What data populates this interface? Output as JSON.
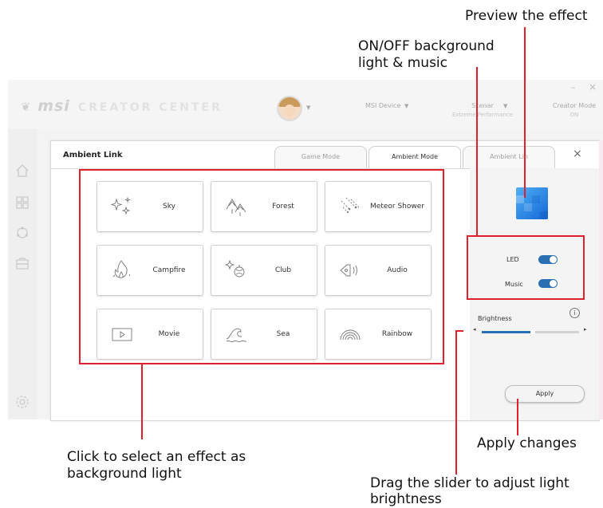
{
  "callouts": {
    "preview": "Preview the effect",
    "onoff_line1": "ON/OFF background",
    "onoff_line2": "light & music",
    "select_line1": "Click to select an effect as",
    "select_line2": "background light",
    "apply": "Apply changes",
    "slider_line1": "Drag the slider to adjust light",
    "slider_line2": "brightness"
  },
  "app": {
    "brand": "msi",
    "brand_suffix": "CREATOR CENTER",
    "window_controls": {
      "minimize": "–",
      "close": "×"
    },
    "topbar": {
      "device_label": "MSI Device",
      "scenario_label": "Scenar",
      "scenario_value": "Extreme Performance",
      "creator_label": "Creator Mode",
      "creator_value": "ON"
    },
    "sidebar_icons": [
      "home-icon",
      "apps-icon",
      "network-icon",
      "toolbox-icon",
      "settings-icon"
    ]
  },
  "panel": {
    "title": "Ambient Link",
    "tabs": [
      {
        "label": "Game Mode",
        "active": false
      },
      {
        "label": "Ambient Mode",
        "active": true
      },
      {
        "label": "Ambient Lin",
        "active": false
      }
    ],
    "close": "×",
    "effects": [
      {
        "label": "Sky",
        "icon": "sky-sparkle-icon"
      },
      {
        "label": "Forest",
        "icon": "forest-icon"
      },
      {
        "label": "Meteor Shower",
        "icon": "meteor-icon"
      },
      {
        "label": "Campfire",
        "icon": "campfire-icon"
      },
      {
        "label": "Club",
        "icon": "club-icon"
      },
      {
        "label": "Audio",
        "icon": "audio-icon"
      },
      {
        "label": "Movie",
        "icon": "movie-icon"
      },
      {
        "label": "Sea",
        "icon": "sea-wave-icon"
      },
      {
        "label": "Rainbow",
        "icon": "rainbow-icon"
      }
    ],
    "right": {
      "led_label": "LED",
      "led_on": true,
      "music_label": "Music",
      "music_on": true,
      "brightness_label": "Brightness",
      "info_icon": "i",
      "brightness_level": 0.5,
      "apply_label": "Apply",
      "preview_color": "#1e88e5"
    }
  },
  "colors": {
    "callout_red": "#e0202a",
    "toggle_blue": "#2a6fb3",
    "slider_blue": "#2a6fb3"
  }
}
